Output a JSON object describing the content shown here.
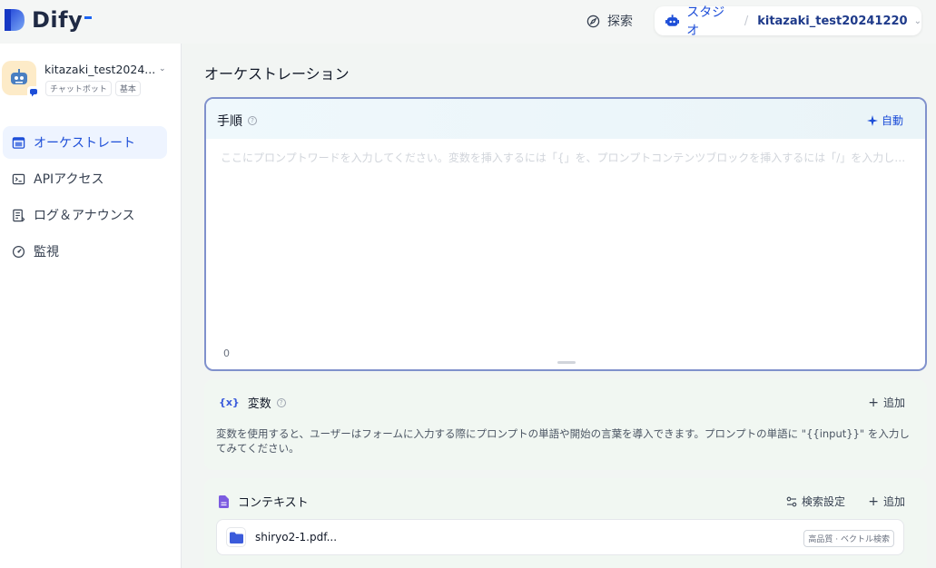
{
  "header": {
    "logo_text": "Dify",
    "explore_label": "探索",
    "studio_label": "スタジオ",
    "app_name": "kitazaki_test20241220"
  },
  "sidebar": {
    "app_title": "kitazaki_test2024...",
    "tags": [
      "チャットボット",
      "基本"
    ],
    "items": [
      {
        "label": "オーケストレート",
        "icon": "layout-icon",
        "active": true
      },
      {
        "label": "APIアクセス",
        "icon": "terminal-icon"
      },
      {
        "label": "ログ＆アナウンス",
        "icon": "log-icon"
      },
      {
        "label": "監視",
        "icon": "gauge-icon"
      }
    ]
  },
  "main": {
    "title": "オーケストレーション",
    "prompt": {
      "title": "手順",
      "auto_label": "自動",
      "placeholder": "ここにプロンプトワードを入力してください。変数を挿入するには「{」を、プロンプトコンテンツブロックを挿入するには「/」を入力します。",
      "char_count": "0"
    },
    "variables": {
      "icon_text": "{x}",
      "title": "変数",
      "add_label": "追加",
      "description": "変数を使用すると、ユーザーはフォームに入力する際にプロンプトの単語や開始の言葉を導入できます。プロンプトの単語に \"{{input}}\" を入力してみてください。"
    },
    "context": {
      "title": "コンテキスト",
      "search_settings_label": "検索設定",
      "add_label": "追加",
      "file_name": "shiryo2-1.pdf...",
      "file_badge": "高品質 · ベクトル検索"
    }
  },
  "colors": {
    "accent": "#1d4ed8",
    "prompt_border": "#8091cc",
    "card_bg": "#f1f7f2"
  }
}
